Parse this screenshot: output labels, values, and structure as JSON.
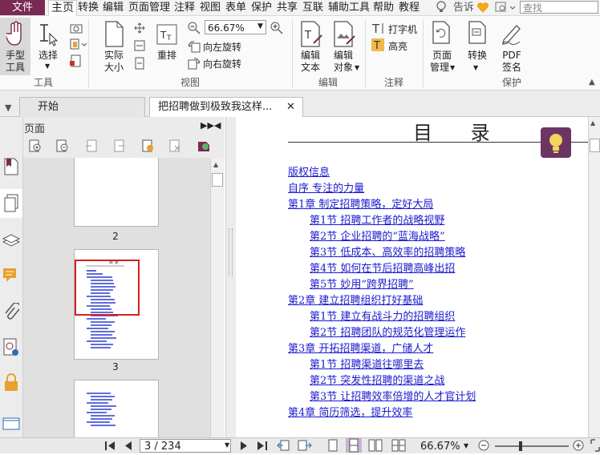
{
  "menu": {
    "file": "文件",
    "items": [
      "主页",
      "转换",
      "编辑",
      "页面管理",
      "注释",
      "视图",
      "表单",
      "保护",
      "共享",
      "互联",
      "辅助工具",
      "帮助",
      "教程"
    ],
    "tell_me": "告诉",
    "search_placeholder": "查找"
  },
  "ribbon": {
    "hand_tool": [
      "手型",
      "工具"
    ],
    "select": "选择",
    "group_tools": "工具",
    "actual_size": [
      "实际",
      "大小"
    ],
    "reflow": "重排",
    "zoom_value": "66.67%",
    "rotate_left": "向左旋转",
    "rotate_right": "向右旋转",
    "group_view": "视图",
    "edit_text": [
      "编辑",
      "文本"
    ],
    "edit_object": [
      "编辑",
      "对象"
    ],
    "group_edit": "编辑",
    "typewriter": "打字机",
    "highlight": "高亮",
    "group_comment": "注释",
    "page_manage": [
      "页面",
      "管理"
    ],
    "convert": "转换",
    "pdf_sign": [
      "PDF",
      "签名"
    ],
    "group_protect": "保护"
  },
  "tabs": {
    "start": "开始",
    "document": "把招聘做到极致我这样..."
  },
  "pages_panel": {
    "title": "页面",
    "thumb_labels": [
      "2",
      "3"
    ]
  },
  "document": {
    "toc_title": "目  录",
    "toc": [
      {
        "text": "版权信息",
        "indent": 0
      },
      {
        "text": "自序 专注的力量",
        "indent": 0
      },
      {
        "text": "第1章 制定招聘策略，定好大局",
        "indent": 0
      },
      {
        "text": "第1节 招聘工作者的战略视野",
        "indent": 1
      },
      {
        "text": "第2节 企业招聘的“蓝海战略”",
        "indent": 1
      },
      {
        "text": "第3节 低成本、高效率的招聘策略",
        "indent": 1
      },
      {
        "text": "第4节 如何在节后招聘高峰出招",
        "indent": 1
      },
      {
        "text": "第5节 妙用“跨界招聘”",
        "indent": 1
      },
      {
        "text": "第2章 建立招聘组织打好基础",
        "indent": 0
      },
      {
        "text": "第1节 建立有战斗力的招聘组织",
        "indent": 1
      },
      {
        "text": "第2节 招聘团队的规范化管理运作",
        "indent": 1
      },
      {
        "text": "第3章 开拓招聘渠道，广储人才",
        "indent": 0
      },
      {
        "text": "第1节 招聘渠道往哪里去",
        "indent": 1
      },
      {
        "text": "第2节 突发性招聘的渠道之战",
        "indent": 1
      },
      {
        "text": "第3节 让招聘效率倍增的人才官计划",
        "indent": 1
      },
      {
        "text": "第4章 简历筛选，提升效率",
        "indent": 0
      }
    ]
  },
  "status": {
    "page_field": "3 / 234",
    "zoom": "66.67%"
  },
  "colors": {
    "brand": "#7a2a52",
    "link": "#1a1ad0",
    "bulb_bg": "#6b3663"
  }
}
